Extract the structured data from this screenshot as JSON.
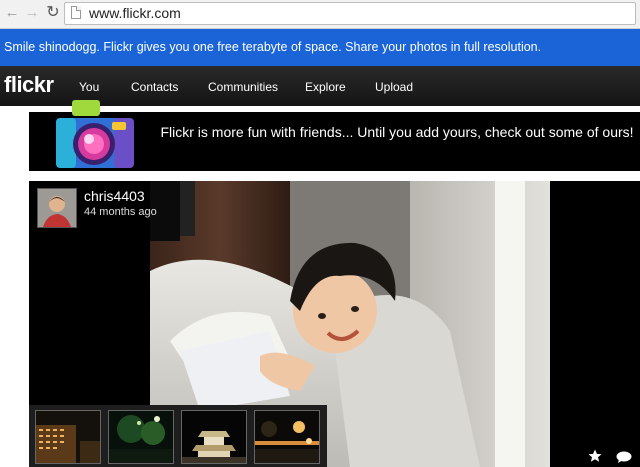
{
  "browser": {
    "back_icon": "back-arrow-icon",
    "forward_icon": "forward-arrow-icon",
    "reload_icon": "reload-icon",
    "url": "www.flickr.com"
  },
  "notice": {
    "text": "Smile shinodogg. Flickr gives you one free terabyte of space. Share your photos in full resolution."
  },
  "nav": {
    "logo": "flickr",
    "items": [
      "You",
      "Contacts",
      "Communities",
      "Explore",
      "Upload"
    ]
  },
  "banner": {
    "text": "Flickr is more fun with friends... Until you add yours, check out some of ours!"
  },
  "photo_card": {
    "username": "chris4403",
    "time_ago": "44 months ago",
    "actions": [
      "star-icon",
      "comment-icon"
    ]
  },
  "colors": {
    "notice_blue": "#1a64d8",
    "nav_black": "#1a1a1a"
  }
}
